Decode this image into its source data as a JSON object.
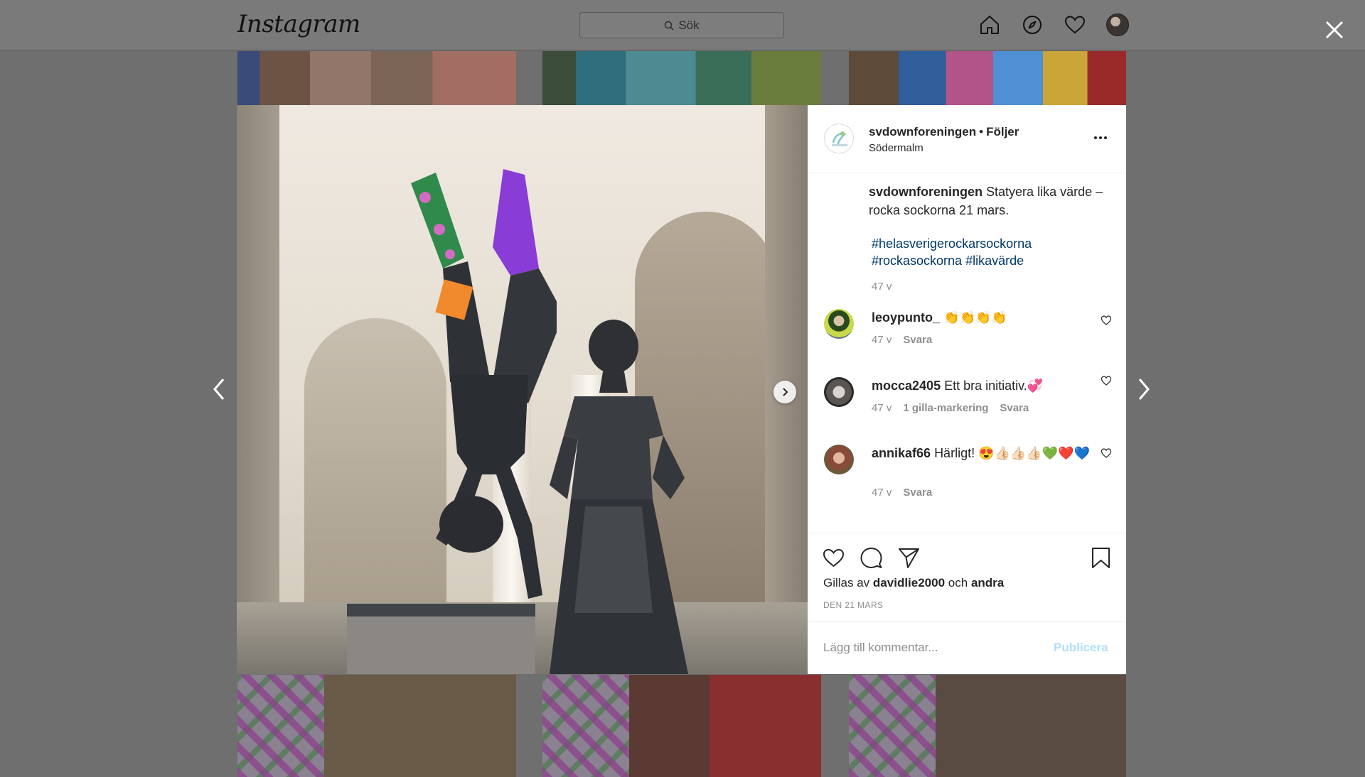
{
  "topbar": {
    "logo": "Instagram",
    "search_placeholder": "Sök",
    "icons": [
      "home-icon",
      "explore-icon",
      "heart-icon",
      "profile-avatar"
    ]
  },
  "post": {
    "username": "svdownforeningen",
    "separator": "•",
    "follow_label": "Följer",
    "location": "Södermalm",
    "caption_user": "svdownforeningen",
    "caption_text": "Statyera lika värde – rocka sockorna 21 mars.",
    "hashtags": [
      "#helasverigerockarsockorna",
      "#rockasockorna",
      "#likavärde"
    ],
    "caption_time": "47 v",
    "comments": [
      {
        "user": "leoypunto_",
        "text": "👏👏👏👏",
        "time": "47 v",
        "likes": "",
        "reply": "Svara"
      },
      {
        "user": "mocca2405",
        "text": "Ett bra initiativ.💞",
        "time": "47 v",
        "likes": "1 gilla-markering",
        "reply": "Svara"
      },
      {
        "user": "annikaf66",
        "text": "Härligt! 😍👍🏻👍🏻👍🏻💚❤️💙",
        "time": "47 v",
        "likes": "",
        "reply": "Svara"
      }
    ],
    "liked_by_prefix": "Gillas av",
    "liked_by_user": "davidlie2000",
    "liked_by_and": "och",
    "liked_by_others": "andra",
    "date": "DEN 21 MARS",
    "add_comment_placeholder": "Lägg till kommentar...",
    "publish_label": "Publicera"
  },
  "colors": {
    "overlay": "#6f6f6f",
    "panel_bg": "#ffffff",
    "text": "#262626",
    "muted": "#8e8e8e",
    "hashtag": "#00376b",
    "publish_disabled": "#b2dffc"
  }
}
